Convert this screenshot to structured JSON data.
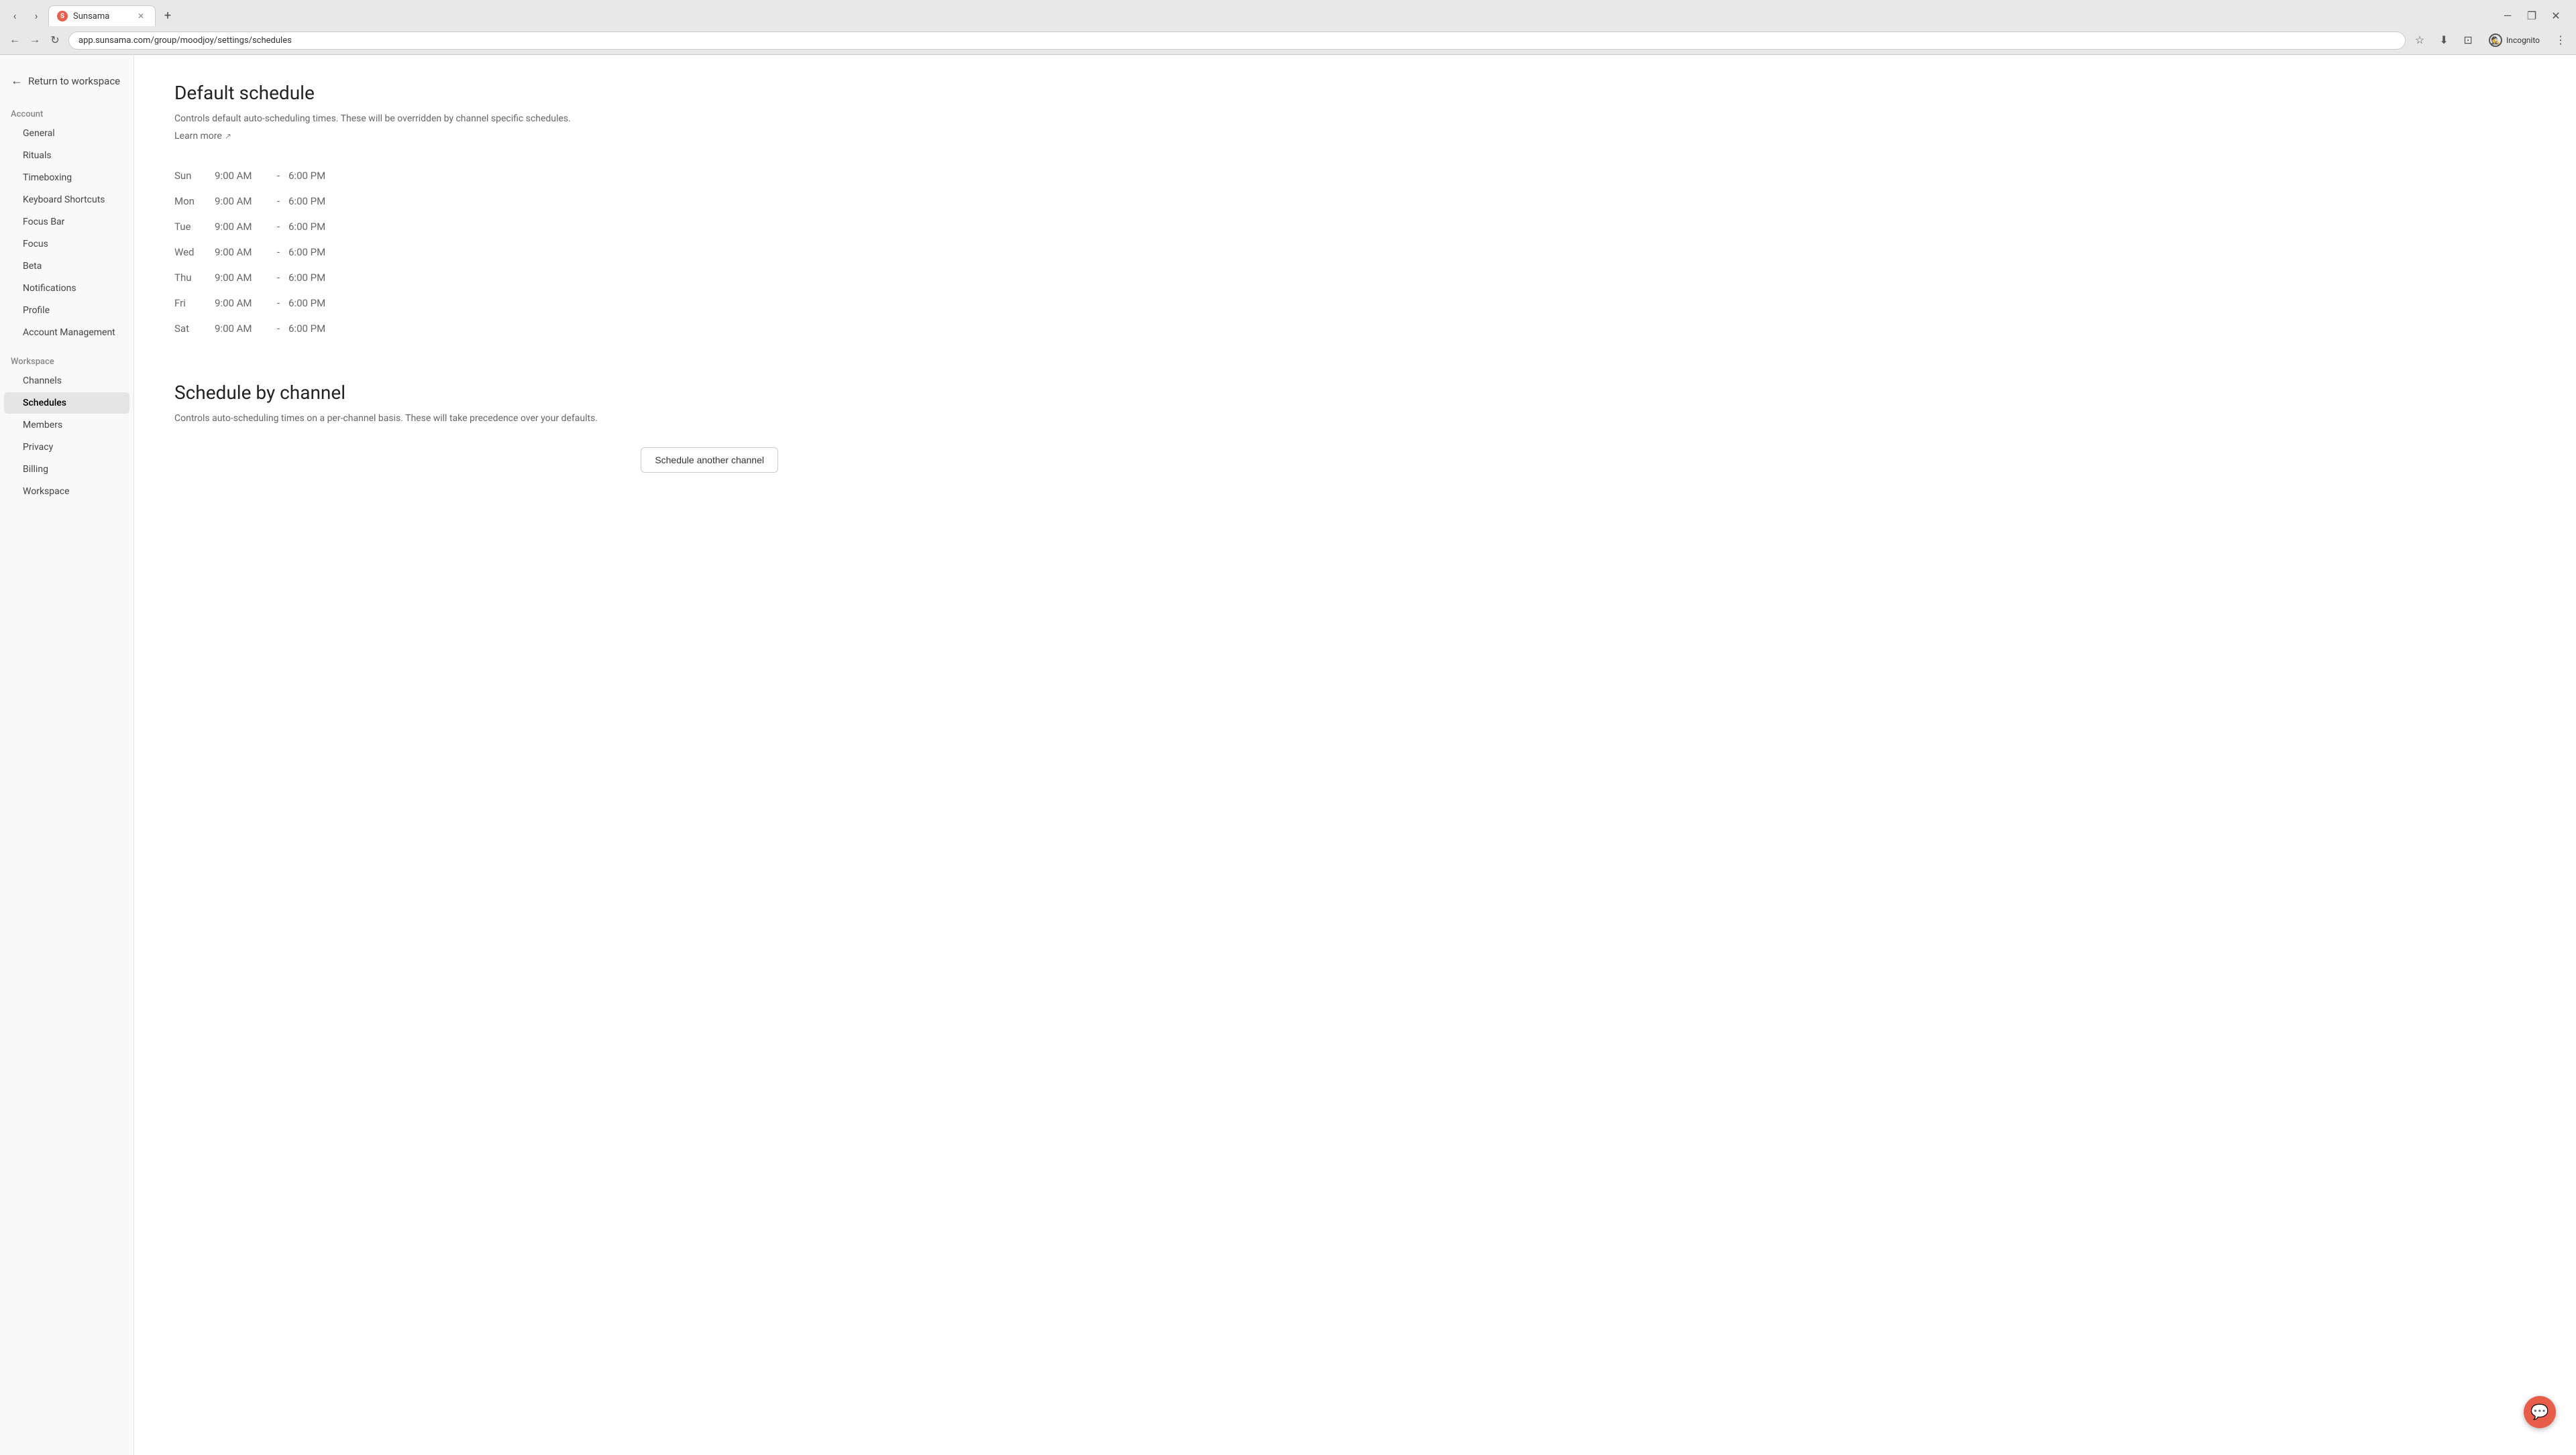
{
  "browser": {
    "tab_title": "Sunsama",
    "tab_favicon_letter": "S",
    "url": "app.sunsama.com/group/moodjoy/settings/schedules",
    "new_tab_label": "+",
    "back_label": "←",
    "forward_label": "→",
    "refresh_label": "↻",
    "incognito_label": "Incognito",
    "minimize_label": "—",
    "maximize_label": "❐",
    "close_label": "✕"
  },
  "sidebar": {
    "return_label": "Return to workspace",
    "account_section_label": "Account",
    "workspace_section_label": "Workspace",
    "account_items": [
      {
        "label": "General",
        "active": false,
        "id": "general"
      },
      {
        "label": "Rituals",
        "active": false,
        "id": "rituals"
      },
      {
        "label": "Timeboxing",
        "active": false,
        "id": "timeboxing"
      },
      {
        "label": "Keyboard Shortcuts",
        "active": false,
        "id": "keyboard-shortcuts"
      },
      {
        "label": "Focus Bar",
        "active": false,
        "id": "focus-bar"
      },
      {
        "label": "Focus",
        "active": false,
        "id": "focus"
      },
      {
        "label": "Beta",
        "active": false,
        "id": "beta"
      },
      {
        "label": "Notifications",
        "active": false,
        "id": "notifications"
      },
      {
        "label": "Profile",
        "active": false,
        "id": "profile"
      },
      {
        "label": "Account Management",
        "active": false,
        "id": "account-management"
      }
    ],
    "workspace_items": [
      {
        "label": "Channels",
        "active": false,
        "id": "channels"
      },
      {
        "label": "Schedules",
        "active": true,
        "id": "schedules"
      },
      {
        "label": "Members",
        "active": false,
        "id": "members"
      },
      {
        "label": "Privacy",
        "active": false,
        "id": "privacy"
      },
      {
        "label": "Billing",
        "active": false,
        "id": "billing"
      },
      {
        "label": "Workspace",
        "active": false,
        "id": "workspace"
      }
    ]
  },
  "main": {
    "default_schedule": {
      "title": "Default schedule",
      "description": "Controls default auto-scheduling times. These will be overridden by channel specific schedules.",
      "learn_more_label": "Learn more",
      "schedule_rows": [
        {
          "day": "Sun",
          "start": "9:00 AM",
          "dash": "-",
          "end": "6:00 PM"
        },
        {
          "day": "Mon",
          "start": "9:00 AM",
          "dash": "-",
          "end": "6:00 PM"
        },
        {
          "day": "Tue",
          "start": "9:00 AM",
          "dash": "-",
          "end": "6:00 PM"
        },
        {
          "day": "Wed",
          "start": "9:00 AM",
          "dash": "-",
          "end": "6:00 PM"
        },
        {
          "day": "Thu",
          "start": "9:00 AM",
          "dash": "-",
          "end": "6:00 PM"
        },
        {
          "day": "Fri",
          "start": "9:00 AM",
          "dash": "-",
          "end": "6:00 PM"
        },
        {
          "day": "Sat",
          "start": "9:00 AM",
          "dash": "-",
          "end": "6:00 PM"
        }
      ]
    },
    "schedule_by_channel": {
      "title": "Schedule by channel",
      "description": "Controls auto-scheduling times on a per-channel basis. These will take precedence over your defaults.",
      "schedule_another_btn_label": "Schedule another channel"
    }
  },
  "chat_fab": {
    "icon": "💬"
  }
}
